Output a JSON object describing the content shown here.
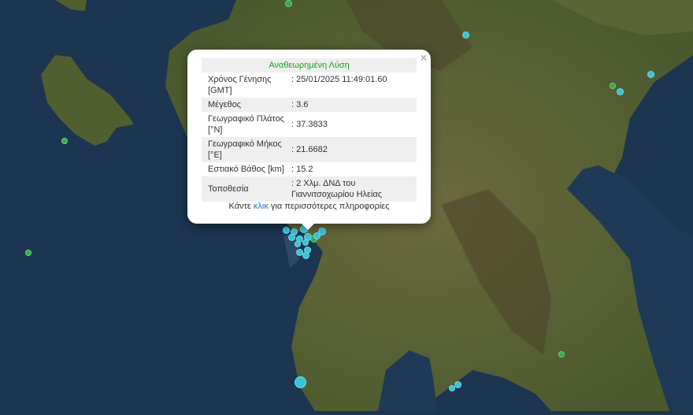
{
  "popup": {
    "title": "Αναθεωρημένη Λύση",
    "close_symbol": "×",
    "rows": [
      {
        "label": "Χρόνος Γένησης [GMT]",
        "value": ": 25/01/2025 11:49:01.60"
      },
      {
        "label": "Μέγεθος",
        "value": ": 3.6"
      },
      {
        "label": "Γεωγραφικό Πλάτος [°N]",
        "value": ": 37.3833"
      },
      {
        "label": "Γεωγραφικό Μήκος [°E]",
        "value": ": 21.6682"
      },
      {
        "label": "Εστιακό Βάθος [km]",
        "value": ": 15.2"
      },
      {
        "label": "Τοποθεσία",
        "value": ": 2 Χλμ. ΔΝΔ του Γιαννιτσοχωρίου Ηλείας"
      }
    ],
    "info_prefix": "Κάντε",
    "info_link": "κλικ",
    "info_suffix": "για περισσότερες πληροφορίες"
  },
  "colors": {
    "sea": "#1c3550",
    "land": "#4e5a2f",
    "recent_marker": "#34c5d8",
    "older_marker": "#2fae47",
    "title_green": "#1f9d1f",
    "link_blue": "#1a73c8"
  },
  "markers": {
    "recent_type": "cyan-circle",
    "older_type": "green-circle"
  }
}
